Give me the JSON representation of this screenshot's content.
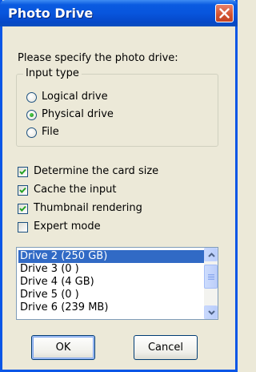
{
  "window": {
    "title": "Photo Drive"
  },
  "prompt": "Please specify the photo drive:",
  "input_type": {
    "legend": "Input type",
    "options": [
      {
        "label": "Logical drive",
        "selected": false
      },
      {
        "label": "Physical drive",
        "selected": true
      },
      {
        "label": "File",
        "selected": false
      }
    ]
  },
  "options": [
    {
      "label": "Determine the card size",
      "checked": true
    },
    {
      "label": "Cache the input",
      "checked": true
    },
    {
      "label": "Thumbnail rendering",
      "checked": true
    },
    {
      "label": "Expert mode",
      "checked": false
    }
  ],
  "drive_list": {
    "items": [
      "Drive 2 (250 GB)",
      "Drive 3 (0 )",
      "Drive 4 (4 GB)",
      "Drive 5 (0 )",
      "Drive 6 (239 MB)"
    ],
    "selected_index": 0
  },
  "buttons": {
    "ok": "OK",
    "cancel": "Cancel"
  },
  "colors": {
    "titlebar": "#0855dd",
    "selection": "#316ac5",
    "close_button": "#d2522f",
    "check_mark": "#21a121"
  }
}
